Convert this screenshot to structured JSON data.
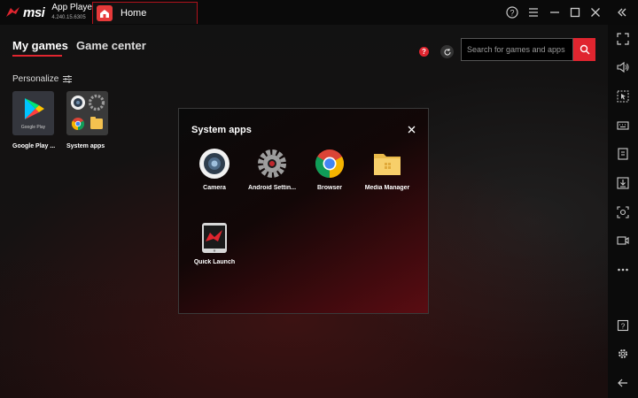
{
  "titlebar": {
    "brand": "msi",
    "app_name": "App Player",
    "version": "4.240.15.6305",
    "home_tab": "Home"
  },
  "main": {
    "tabs": [
      {
        "label": "My games",
        "active": true
      },
      {
        "label": "Game center",
        "active": false
      }
    ],
    "personalize_label": "Personalize",
    "help_badge": "?",
    "search": {
      "placeholder": "Search for games and apps"
    },
    "tiles": [
      {
        "label": "Google Play ...",
        "icon_caption": "Google Play"
      },
      {
        "label": "System apps"
      }
    ]
  },
  "modal": {
    "title": "System apps",
    "apps": [
      {
        "label": "Camera",
        "icon": "camera-icon"
      },
      {
        "label": "Android Settin...",
        "icon": "settings-gear-icon"
      },
      {
        "label": "Browser",
        "icon": "chrome-icon"
      },
      {
        "label": "Media Manager",
        "icon": "folder-icon"
      },
      {
        "label": "Quick Launch",
        "icon": "quick-launch-icon"
      }
    ]
  },
  "colors": {
    "accent": "#e0252f",
    "background": "#0d0d0d",
    "sidebar": "#0b0b0b"
  }
}
